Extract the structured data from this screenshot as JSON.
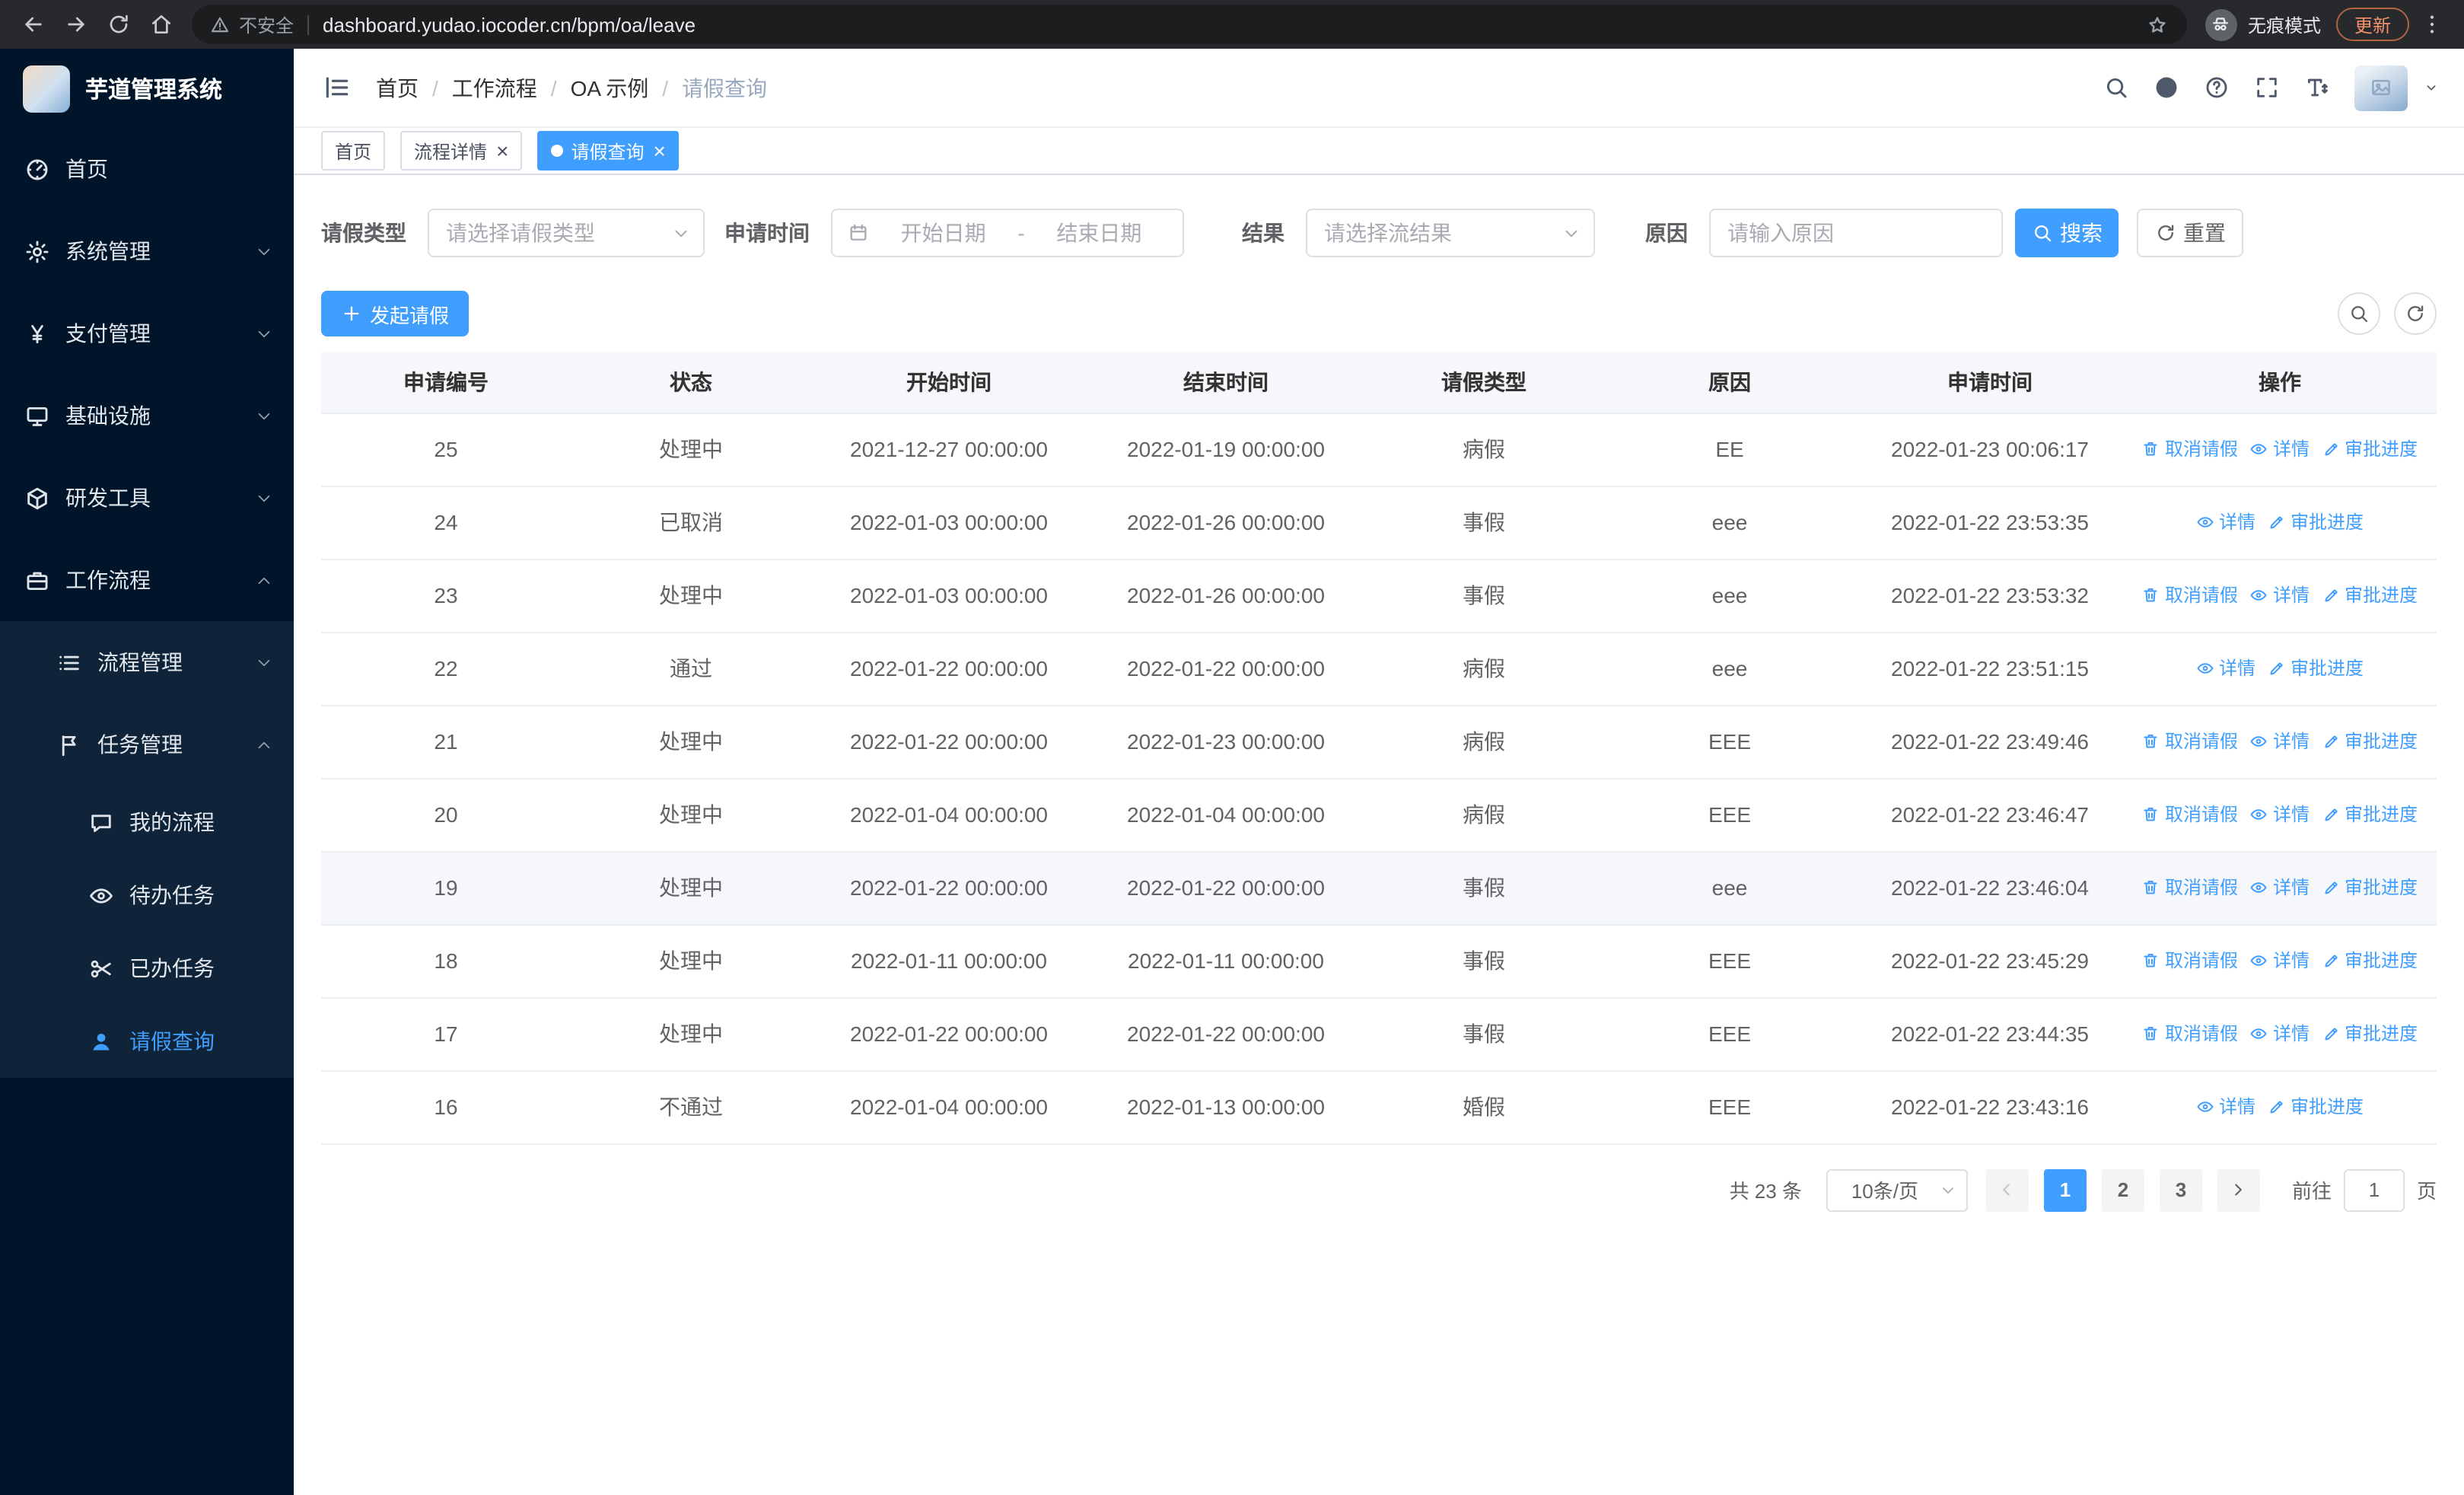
{
  "colors": {
    "accent": "#409eff",
    "sidebar_bg": "#001529",
    "update_badge": "#f0926a"
  },
  "browser": {
    "security_label": "不安全",
    "url": "dashboard.yudao.iocoder.cn/bpm/oa/leave",
    "incognito_label": "无痕模式",
    "update_label": "更新"
  },
  "sidebar": {
    "logo_title": "芋道管理系统",
    "items": [
      {
        "id": "home",
        "label": "首页",
        "icon": "dashboard-icon",
        "level": 1
      },
      {
        "id": "system",
        "label": "系统管理",
        "icon": "gear-icon",
        "level": 1,
        "expandable": true,
        "expanded": false
      },
      {
        "id": "payment",
        "label": "支付管理",
        "icon": "yen-icon",
        "level": 1,
        "expandable": true,
        "expanded": false
      },
      {
        "id": "infrastructure",
        "label": "基础设施",
        "icon": "monitor-icon",
        "level": 1,
        "expandable": true,
        "expanded": false
      },
      {
        "id": "devtools",
        "label": "研发工具",
        "icon": "cube-icon",
        "level": 1,
        "expandable": true,
        "expanded": false
      },
      {
        "id": "workflow",
        "label": "工作流程",
        "icon": "briefcase-icon",
        "level": 1,
        "expandable": true,
        "expanded": true
      },
      {
        "id": "process-management",
        "label": "流程管理",
        "icon": "list-icon",
        "level": 2,
        "expandable": true,
        "expanded": false
      },
      {
        "id": "task-management",
        "label": "任务管理",
        "icon": "flag-icon",
        "level": 2,
        "expandable": true,
        "expanded": true
      },
      {
        "id": "my-process",
        "label": "我的流程",
        "icon": "chat-icon",
        "level": 3
      },
      {
        "id": "todo-tasks",
        "label": "待办任务",
        "icon": "eye-icon",
        "level": 3
      },
      {
        "id": "done-tasks",
        "label": "已办任务",
        "icon": "scissors-icon",
        "level": 3
      },
      {
        "id": "leave-query",
        "label": "请假查询",
        "icon": "person-icon",
        "level": 3,
        "active": true
      }
    ]
  },
  "header": {
    "breadcrumb": [
      "首页",
      "工作流程",
      "OA 示例",
      "请假查询"
    ]
  },
  "tabs": [
    {
      "id": "home",
      "label": "首页",
      "closable": false,
      "active": false
    },
    {
      "id": "process-detail",
      "label": "流程详情",
      "closable": true,
      "active": false
    },
    {
      "id": "leave-query",
      "label": "请假查询",
      "closable": true,
      "active": true
    }
  ],
  "filters": {
    "leave_type_label": "请假类型",
    "leave_type_placeholder": "请选择请假类型",
    "apply_time_label": "申请时间",
    "start_date_placeholder": "开始日期",
    "range_separator": "-",
    "end_date_placeholder": "结束日期",
    "result_label": "结果",
    "result_placeholder": "请选择流结果",
    "reason_label": "原因",
    "reason_placeholder": "请输入原因",
    "search_label": "搜索",
    "reset_label": "重置"
  },
  "toolbar": {
    "create_label": "发起请假"
  },
  "table": {
    "columns": [
      "申请编号",
      "状态",
      "开始时间",
      "结束时间",
      "请假类型",
      "原因",
      "申请时间",
      "操作"
    ],
    "op_labels": {
      "cancel": "取消请假",
      "detail": "详情",
      "progress": "审批进度"
    },
    "rows": [
      {
        "id": "25",
        "status": "处理中",
        "start": "2021-12-27 00:00:00",
        "end": "2022-01-19 00:00:00",
        "type": "病假",
        "reason": "EE",
        "apply_time": "2022-01-23 00:06:17",
        "ops": [
          "cancel",
          "detail",
          "progress"
        ]
      },
      {
        "id": "24",
        "status": "已取消",
        "start": "2022-01-03 00:00:00",
        "end": "2022-01-26 00:00:00",
        "type": "事假",
        "reason": "eee",
        "apply_time": "2022-01-22 23:53:35",
        "ops": [
          "detail",
          "progress"
        ]
      },
      {
        "id": "23",
        "status": "处理中",
        "start": "2022-01-03 00:00:00",
        "end": "2022-01-26 00:00:00",
        "type": "事假",
        "reason": "eee",
        "apply_time": "2022-01-22 23:53:32",
        "ops": [
          "cancel",
          "detail",
          "progress"
        ]
      },
      {
        "id": "22",
        "status": "通过",
        "start": "2022-01-22 00:00:00",
        "end": "2022-01-22 00:00:00",
        "type": "病假",
        "reason": "eee",
        "apply_time": "2022-01-22 23:51:15",
        "ops": [
          "detail",
          "progress"
        ]
      },
      {
        "id": "21",
        "status": "处理中",
        "start": "2022-01-22 00:00:00",
        "end": "2022-01-23 00:00:00",
        "type": "病假",
        "reason": "EEE",
        "apply_time": "2022-01-22 23:49:46",
        "ops": [
          "cancel",
          "detail",
          "progress"
        ]
      },
      {
        "id": "20",
        "status": "处理中",
        "start": "2022-01-04 00:00:00",
        "end": "2022-01-04 00:00:00",
        "type": "病假",
        "reason": "EEE",
        "apply_time": "2022-01-22 23:46:47",
        "ops": [
          "cancel",
          "detail",
          "progress"
        ]
      },
      {
        "id": "19",
        "status": "处理中",
        "start": "2022-01-22 00:00:00",
        "end": "2022-01-22 00:00:00",
        "type": "事假",
        "reason": "eee",
        "apply_time": "2022-01-22 23:46:04",
        "ops": [
          "cancel",
          "detail",
          "progress"
        ],
        "highlighted": true
      },
      {
        "id": "18",
        "status": "处理中",
        "start": "2022-01-11 00:00:00",
        "end": "2022-01-11 00:00:00",
        "type": "事假",
        "reason": "EEE",
        "apply_time": "2022-01-22 23:45:29",
        "ops": [
          "cancel",
          "detail",
          "progress"
        ]
      },
      {
        "id": "17",
        "status": "处理中",
        "start": "2022-01-22 00:00:00",
        "end": "2022-01-22 00:00:00",
        "type": "事假",
        "reason": "EEE",
        "apply_time": "2022-01-22 23:44:35",
        "ops": [
          "cancel",
          "detail",
          "progress"
        ]
      },
      {
        "id": "16",
        "status": "不通过",
        "start": "2022-01-04 00:00:00",
        "end": "2022-01-13 00:00:00",
        "type": "婚假",
        "reason": "EEE",
        "apply_time": "2022-01-22 23:43:16",
        "ops": [
          "detail",
          "progress"
        ]
      }
    ]
  },
  "pagination": {
    "total_label": "共 23 条",
    "page_size_label": "10条/页",
    "pages": [
      "1",
      "2",
      "3"
    ],
    "active_page": "1",
    "goto_label": "前往",
    "goto_value": "1",
    "page_unit_label": "页"
  }
}
